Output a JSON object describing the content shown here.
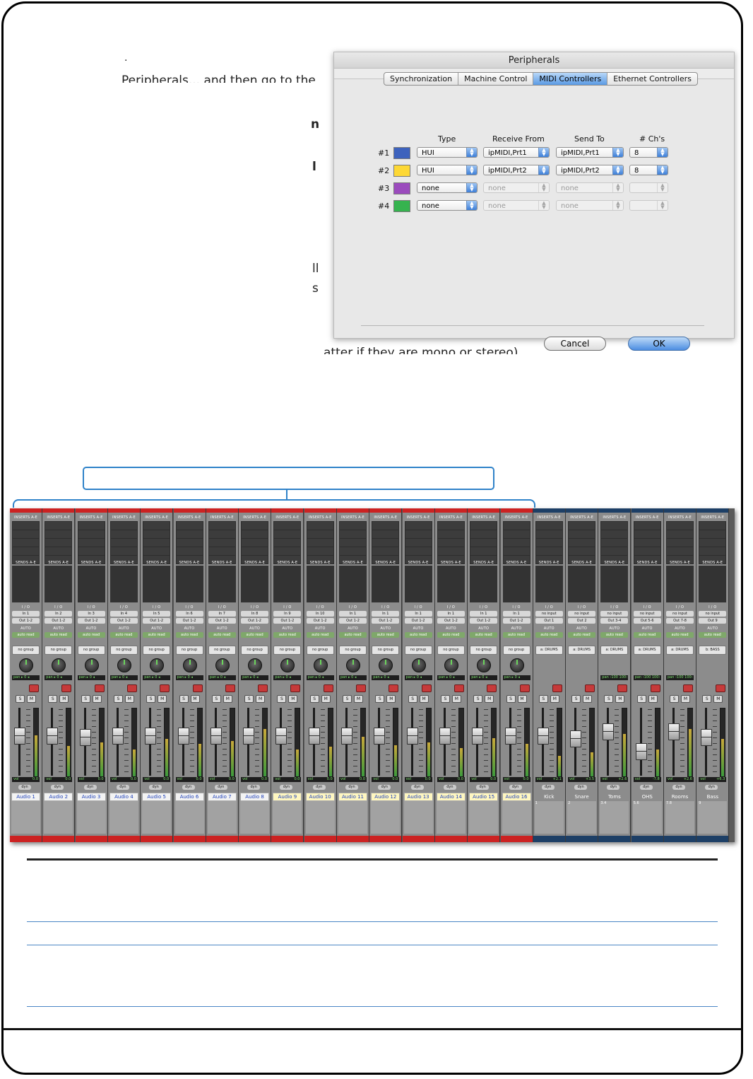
{
  "background_text": {
    "line1": ".",
    "line2": "Peripherals... and then go to the",
    "line3": "n",
    "line4": "l",
    "line5": "ll",
    "line6": "s",
    "line7": "atter if they are mono or stereo)"
  },
  "dialog": {
    "title": "Peripherals",
    "tabs": [
      "Synchronization",
      "Machine Control",
      "MIDI Controllers",
      "Ethernet Controllers"
    ],
    "active_tab": "MIDI Controllers",
    "columns": {
      "type": "Type",
      "receive": "Receive From",
      "send": "Send To",
      "chs": "# Ch's"
    },
    "rows": [
      {
        "label": "#1",
        "color": "#3d62bd",
        "type": "HUI",
        "receive": "ipMIDI,Prt1",
        "send": "ipMIDI,Prt1",
        "chs": "8",
        "enabled": true
      },
      {
        "label": "#2",
        "color": "#fdd835",
        "type": "HUI",
        "receive": "ipMIDI,Prt2",
        "send": "ipMIDI,Prt2",
        "chs": "8",
        "enabled": true
      },
      {
        "label": "#3",
        "color": "#9b4bbd",
        "type": "none",
        "receive": "none",
        "send": "none",
        "chs": "",
        "enabled": false
      },
      {
        "label": "#4",
        "color": "#36b34f",
        "type": "none",
        "receive": "none",
        "send": "none",
        "chs": "",
        "enabled": false
      }
    ],
    "cancel_label": "Cancel",
    "ok_label": "OK"
  },
  "mixer": {
    "inserts_label": "INSERTS A-E",
    "sends_label": "SENDS A-E",
    "io_label": "I / O",
    "auto_label": "AUTO",
    "auto_value": "auto read",
    "pan_label": "pan",
    "vol_label": "vol",
    "dyn_label": "dyn",
    "solo_label": "S",
    "mute_label": "M",
    "strips": [
      {
        "name": "Audio 1",
        "input": "In 1",
        "output": "Out 1-2",
        "group": "no group",
        "vol": "0.0",
        "pan": "▸ 0 ◂",
        "top": "#cc2222",
        "sel": false
      },
      {
        "name": "Audio 2",
        "input": "In 2",
        "output": "Out 1-2",
        "group": "no group",
        "vol": "0.0",
        "pan": "▸ 0 ◂",
        "top": "#cc2222",
        "sel": false
      },
      {
        "name": "Audio 3",
        "input": "In 3",
        "output": "Out 1-2",
        "group": "no group",
        "vol": "0.0",
        "pan": "▸ 0 ◂",
        "top": "#cc2222",
        "sel": false
      },
      {
        "name": "Audio 4",
        "input": "In 4",
        "output": "Out 1-2",
        "group": "no group",
        "vol": "0.0",
        "pan": "▸ 0 ◂",
        "top": "#cc2222",
        "sel": false
      },
      {
        "name": "Audio 5",
        "input": "In 5",
        "output": "Out 1-2",
        "group": "no group",
        "vol": "0.0",
        "pan": "▸ 0 ◂",
        "top": "#cc2222",
        "sel": false
      },
      {
        "name": "Audio 6",
        "input": "In 6",
        "output": "Out 1-2",
        "group": "no group",
        "vol": "0.0",
        "pan": "▸ 0 ◂",
        "top": "#cc2222",
        "sel": false
      },
      {
        "name": "Audio 7",
        "input": "In 7",
        "output": "Out 1-2",
        "group": "no group",
        "vol": "0.0",
        "pan": "▸ 0 ◂",
        "top": "#cc2222",
        "sel": false
      },
      {
        "name": "Audio 8",
        "input": "In 8",
        "output": "Out 1-2",
        "group": "no group",
        "vol": "0.0",
        "pan": "▸ 0 ◂",
        "top": "#cc2222",
        "sel": false
      },
      {
        "name": "Audio 9",
        "input": "In 9",
        "output": "Out 1-2",
        "group": "no group",
        "vol": "0.0",
        "pan": "▸ 0 ◂",
        "top": "#cc2222",
        "sel": true
      },
      {
        "name": "Audio 10",
        "input": "In 10",
        "output": "Out 1-2",
        "group": "no group",
        "vol": "0.0",
        "pan": "▸ 0 ◂",
        "top": "#cc2222",
        "sel": true
      },
      {
        "name": "Audio 11",
        "input": "In 1",
        "output": "Out 1-2",
        "group": "no group",
        "vol": "0.0",
        "pan": "▸ 0 ◂",
        "top": "#cc2222",
        "sel": true
      },
      {
        "name": "Audio 12",
        "input": "In 1",
        "output": "Out 1-2",
        "group": "no group",
        "vol": "0.0",
        "pan": "▸ 0 ◂",
        "top": "#cc2222",
        "sel": true
      },
      {
        "name": "Audio 13",
        "input": "In 1",
        "output": "Out 1-2",
        "group": "no group",
        "vol": "0.0",
        "pan": "▸ 0 ◂",
        "top": "#cc2222",
        "sel": true
      },
      {
        "name": "Audio 14",
        "input": "In 1",
        "output": "Out 1-2",
        "group": "no group",
        "vol": "0.0",
        "pan": "▸ 0 ◂",
        "top": "#cc2222",
        "sel": true
      },
      {
        "name": "Audio 15",
        "input": "In 1",
        "output": "Out 1-2",
        "group": "no group",
        "vol": "0.0",
        "pan": "▸ 0 ◂",
        "top": "#cc2222",
        "sel": true
      },
      {
        "name": "Audio 16",
        "input": "In 1",
        "output": "Out 1-2",
        "group": "no group",
        "vol": "0.0",
        "pan": "▸ 0 ◂",
        "top": "#cc2222",
        "sel": true
      },
      {
        "name": "Kick",
        "input": "no input",
        "output": "Out 1",
        "group": "a: DRUMS",
        "vol": "+2.1",
        "pan": "",
        "top": "#1d3f66",
        "aux": true,
        "num": "1"
      },
      {
        "name": "Snare",
        "input": "no input",
        "output": "Out 2",
        "group": "a: DRUMS",
        "vol": "+3.5",
        "pan": "",
        "top": "#1d3f66",
        "aux": true,
        "num": "2"
      },
      {
        "name": "Toms",
        "input": "no input",
        "output": "Out 3-4",
        "group": "a: DRUMS",
        "vol": "+2.6",
        "pan": "‹100 100›",
        "top": "#1d3f66",
        "aux": true,
        "num": "3.4"
      },
      {
        "name": "OHS",
        "input": "no input",
        "output": "Out 5-6",
        "group": "a: DRUMS",
        "vol": "-7.8",
        "pan": "‹100 100›",
        "top": "#1d3f66",
        "aux": true,
        "num": "5.6"
      },
      {
        "name": "Rooms",
        "input": "no input",
        "output": "Out 7-8",
        "group": "a: DRUMS",
        "vol": "+2.6",
        "pan": "‹100 100›",
        "top": "#1d3f66",
        "aux": true,
        "num": "7.8"
      },
      {
        "name": "Bass",
        "input": "no input",
        "output": "Out 9",
        "group": "b: BASS",
        "vol": "+6.3",
        "pan": "",
        "top": "#1d3f66",
        "aux": true,
        "num": "9"
      }
    ]
  },
  "colors": {
    "accent": "#2f82c9",
    "red_strip": "#cc2222",
    "aux_strip": "#1d3f66"
  }
}
